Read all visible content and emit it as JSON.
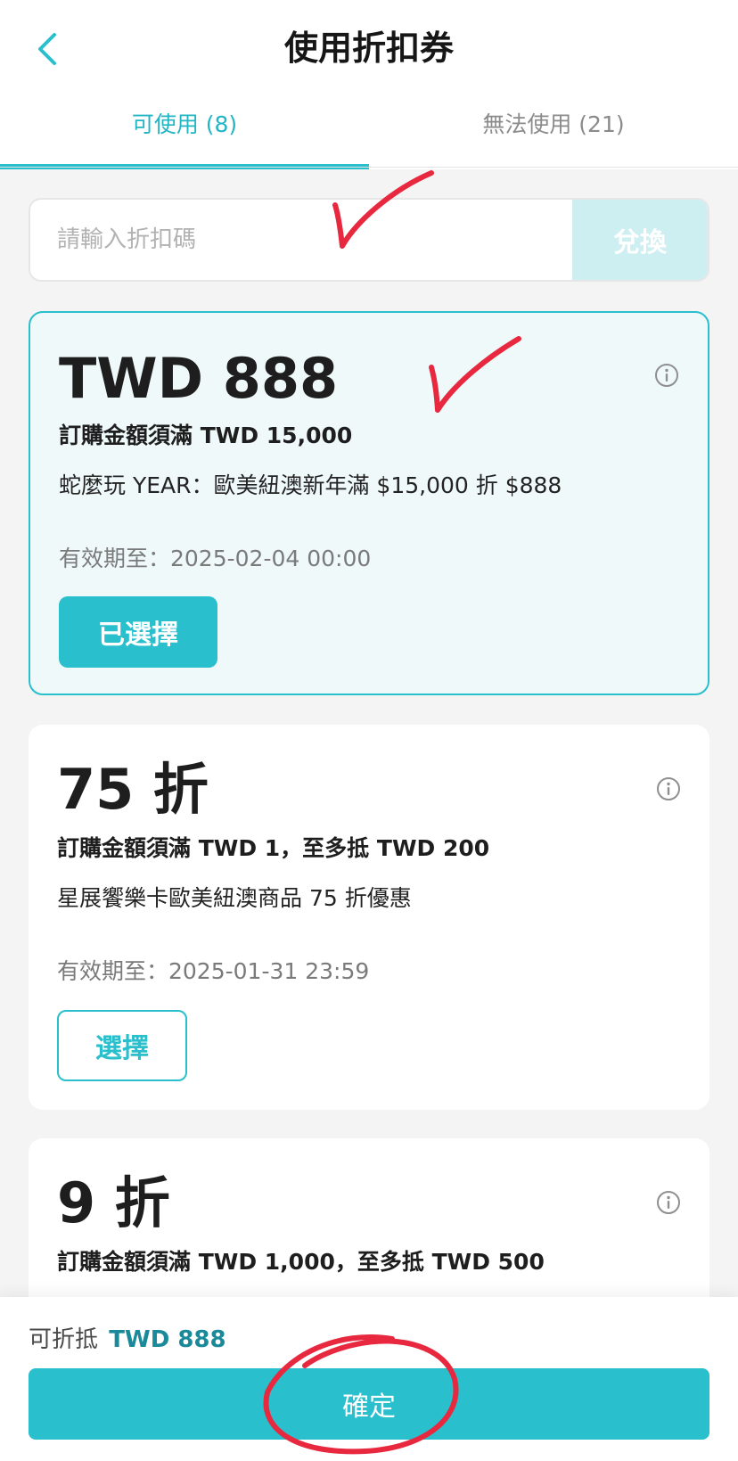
{
  "header": {
    "title": "使用折扣券",
    "back_icon": "chevron-left-icon"
  },
  "tabs": [
    {
      "label": "可使用 (8)",
      "active": true
    },
    {
      "label": "無法使用 (21)",
      "active": false
    }
  ],
  "redeem": {
    "placeholder": "請輸入折扣碼",
    "button_label": "兌換"
  },
  "coupons": [
    {
      "amount": "TWD 888",
      "condition": "訂購金額須滿 TWD 15,000",
      "description": "蛇麼玩 YEAR：歐美紐澳新年滿 $15,000 折 $888",
      "expiry": "有效期至：2025-02-04 00:00",
      "button_label": "已選擇",
      "selected": true
    },
    {
      "amount": "75 折",
      "condition": "訂購金額須滿 TWD 1，至多抵 TWD 200",
      "description": "星展饗樂卡歐美紐澳商品 75 折優惠",
      "expiry": "有效期至：2025-01-31 23:59",
      "button_label": "選擇",
      "selected": false
    },
    {
      "amount": "9 折",
      "condition": "訂購金額須滿 TWD 1,000，至多抵 TWD 500",
      "selected": false
    }
  ],
  "footer": {
    "discount_label": "可折抵",
    "discount_amount": "TWD 888",
    "confirm_label": "確定"
  },
  "colors": {
    "accent": "#29bfcc",
    "accent_text": "#22b5c4",
    "selected_card_bg": "#eff9fa",
    "redeem_button_bg": "#cdeff2",
    "annotation_red": "#e8283e"
  }
}
